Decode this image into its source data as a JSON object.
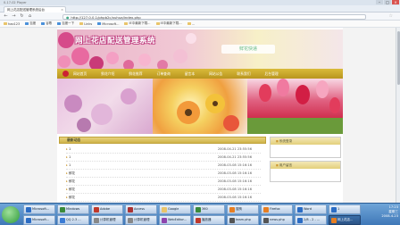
{
  "browser": {
    "title": "0-17-02 Player",
    "tab_title": "网上花店配送管理系统后台",
    "url": "http://127.0.0.1/phpb2c/xuhua/index.php",
    "bookmarks": [
      {
        "label": "hao123",
        "color": "#e9c46a"
      },
      {
        "label": "百度",
        "color": "#4a90d9"
      },
      {
        "label": "谷歌",
        "color": "#4a90d9"
      },
      {
        "label": "百度一下",
        "color": "#4a90d9"
      },
      {
        "label": "Links",
        "color": "#e9c46a"
      },
      {
        "label": "Microsoft...",
        "color": "#4a90d9"
      },
      {
        "label": "IE中最新下载...",
        "color": "#e9c46a"
      },
      {
        "label": "IE中最新下载...",
        "color": "#e9c46a"
      },
      {
        "label": "...",
        "color": "#e9c46a"
      }
    ]
  },
  "site": {
    "banner_title": "网上花店配送管理系统",
    "logo_text": "鲜花快递",
    "menu": [
      "网站首页",
      "鲜花介绍",
      "鲜花推荐",
      "订单查询",
      "留言本",
      "网站公告",
      "联系我们",
      "后台管理"
    ],
    "news_header": "最新动态",
    "news": [
      {
        "title": "1",
        "date": "2008-04-21 23:55:56"
      },
      {
        "title": "1",
        "date": "2008-04-21 23:55:56"
      },
      {
        "title": "1",
        "date": "2008-03-08 15:16:16"
      },
      {
        "title": "鲜花",
        "date": "2008-03-08 15:16:16"
      },
      {
        "title": "鲜花",
        "date": "2008-03-08 15:16:16"
      },
      {
        "title": "鲜花",
        "date": "2008-03-08 15:16:16"
      },
      {
        "title": "鲜花",
        "date": "2008-03-08 15:16:16"
      }
    ],
    "side_login": "系统登录",
    "side_users": "用户留言"
  },
  "taskbar": {
    "row1": [
      {
        "label": "Microsoft...",
        "color": "#2b6cc4"
      },
      {
        "label": "Mindows",
        "color": "#3a8a3a"
      },
      {
        "label": "Adobe",
        "color": "#c0392b"
      },
      {
        "label": "Access",
        "color": "#a33"
      },
      {
        "label": "Google",
        "color": "#e9c46a"
      },
      {
        "label": "360",
        "color": "#3a8a3a"
      },
      {
        "label": "搜狗",
        "color": "#e67e22"
      },
      {
        "label": "Firefox",
        "color": "#e67e22"
      },
      {
        "label": "Word",
        "color": "#2b6cc4"
      },
      {
        "label": "1",
        "color": "#2b6cc4"
      }
    ],
    "row2": [
      {
        "label": "Microsoft...",
        "color": "#2b6cc4",
        "active": false
      },
      {
        "label": "QQ 2.3 ...",
        "color": "#3a7bd5",
        "active": false
      },
      {
        "label": "计算机管理",
        "color": "#888",
        "active": false
      },
      {
        "label": "计算机管理",
        "color": "#888",
        "active": false
      },
      {
        "label": "WebEditor...",
        "color": "#8e44ad",
        "active": false
      },
      {
        "label": "播放器",
        "color": "#c0392b",
        "active": false
      },
      {
        "label": "team.php",
        "color": "#555",
        "active": false
      },
      {
        "label": "news.php",
        "color": "#555",
        "active": false
      },
      {
        "label": "2/8 - 2 - ...",
        "color": "#2b6cc4",
        "active": false
      },
      {
        "label": "网上花店...",
        "color": "#e67e22",
        "active": true
      }
    ],
    "time": "17:23",
    "weekday": "星期三",
    "date": "2008-4-23"
  },
  "colors": {
    "menubar": "#c9a832",
    "accent": "#c04080"
  }
}
